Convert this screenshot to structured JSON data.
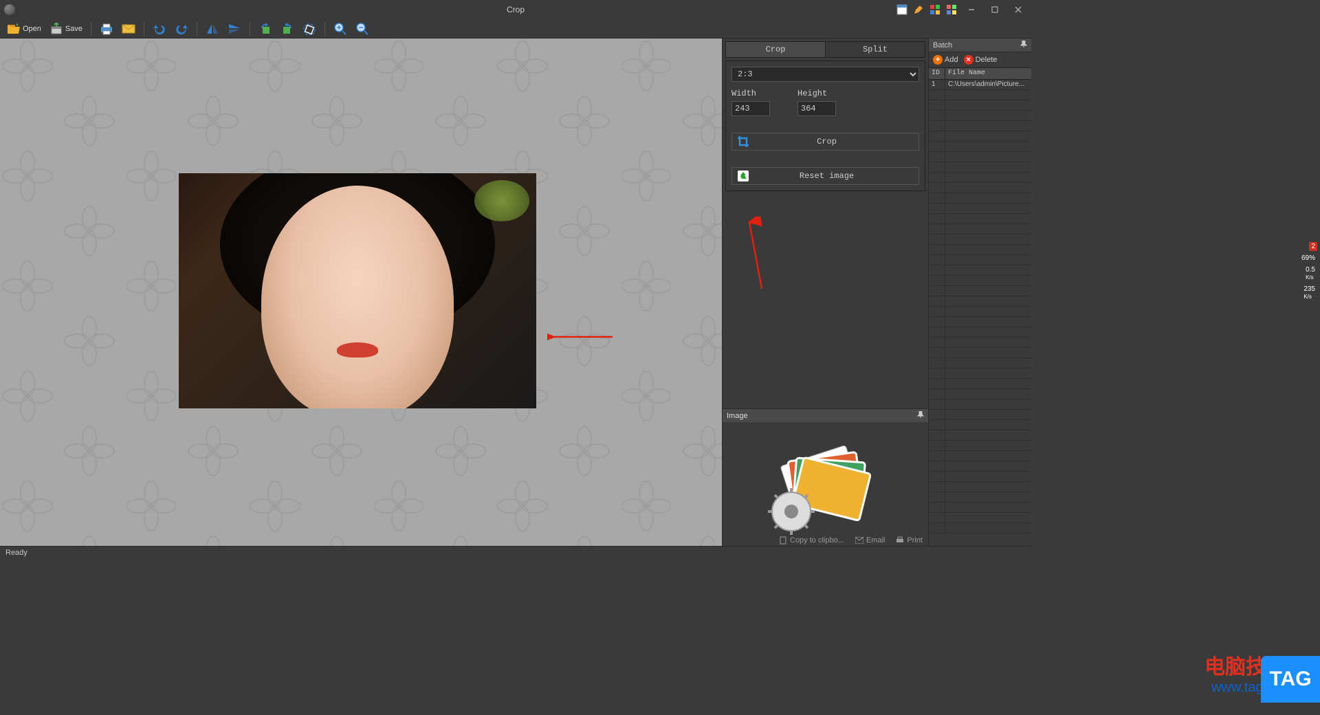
{
  "window": {
    "title": "Crop"
  },
  "toolbar": {
    "open": "Open",
    "save": "Save"
  },
  "tabs": {
    "crop": "Crop",
    "split": "Split"
  },
  "panel": {
    "ratio": "2:3",
    "width_label": "Width",
    "height_label": "Height",
    "width": "243",
    "height": "364",
    "crop_btn": "Crop",
    "reset_btn": "Reset image"
  },
  "image_panel": {
    "header": "Image"
  },
  "batch": {
    "header": "Batch",
    "add": "Add",
    "delete": "Delete",
    "col_id": "ID",
    "col_file": "File Name",
    "rows": [
      {
        "id": "1",
        "file": "C:\\Users\\admin\\Picture..."
      }
    ]
  },
  "status": {
    "ready": "Ready"
  },
  "footer": {
    "copy": "Copy to clipbo...",
    "email": "Email",
    "print": "Print"
  },
  "net": {
    "count": "2",
    "pct": "69%",
    "up": "0.5",
    "down": "235",
    "unit": "K/s"
  },
  "wm": {
    "cn": "电脑技术网",
    "url": "www.tagxp.com",
    "tag": "TAG"
  }
}
